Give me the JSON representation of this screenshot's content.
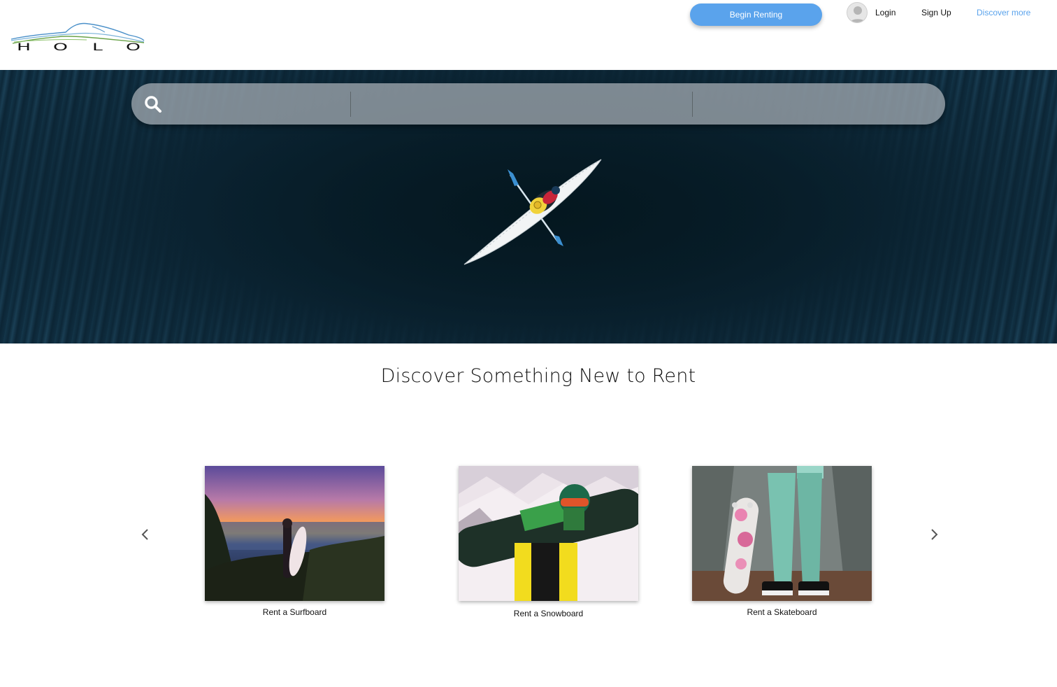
{
  "brand": {
    "logo_letters": [
      "H",
      "O",
      "L",
      "O"
    ],
    "logo_icon": "mountain-outline-logo"
  },
  "header": {
    "begin_renting_label": "Begin Renting",
    "login_label": "Login",
    "signup_label": "Sign Up",
    "discover_label": "Discover more",
    "avatar_icon": "user-avatar-icon"
  },
  "colors": {
    "accent": "#5aa3ec",
    "hero_water": "#0d2839"
  },
  "search": {
    "icon": "search-icon",
    "field1_placeholder": "",
    "field2_placeholder": "",
    "field3_placeholder": ""
  },
  "discover": {
    "title": "Discover Something New to Rent",
    "prev_icon": "chevron-left-icon",
    "next_icon": "chevron-right-icon",
    "cards": [
      {
        "label": "Rent a Surfboard"
      },
      {
        "label": "Rent a Snowboard"
      },
      {
        "label": "Rent a Skateboard"
      }
    ]
  }
}
